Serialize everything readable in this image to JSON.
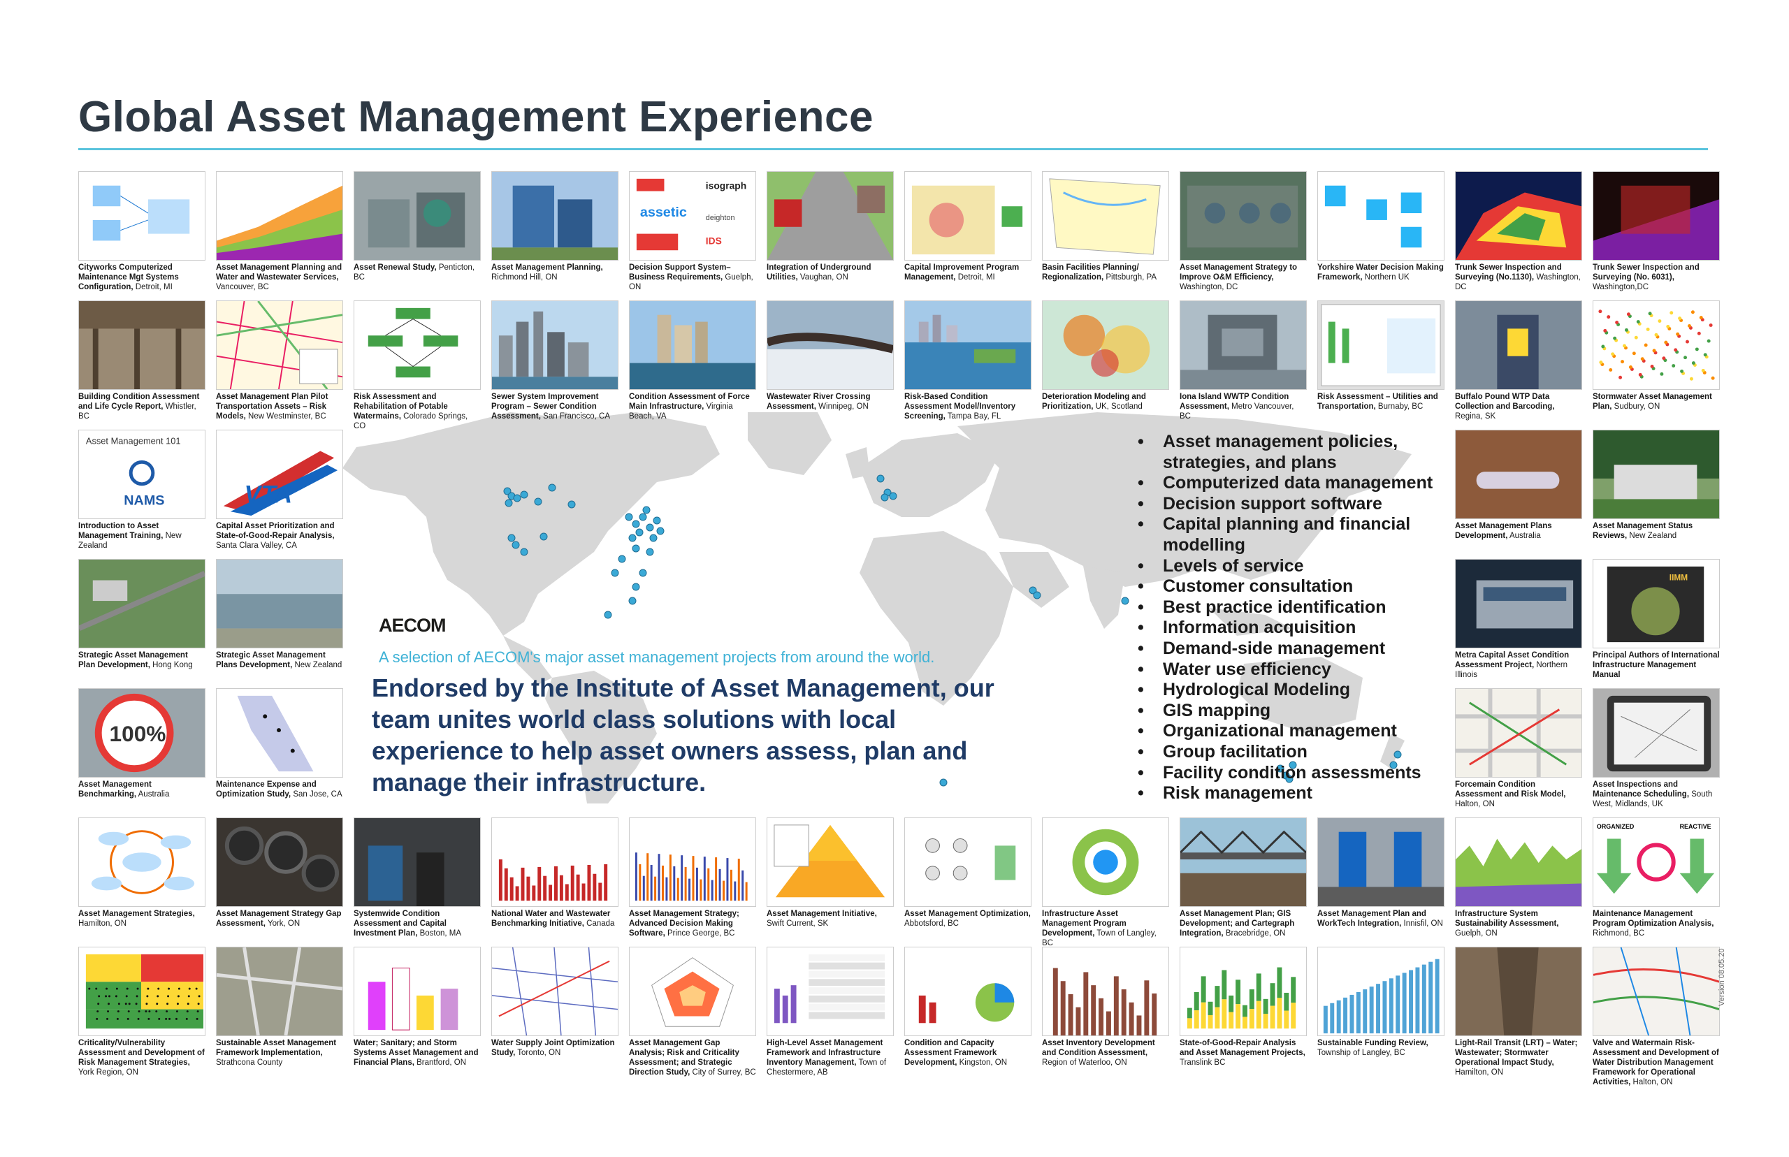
{
  "title": "Global Asset Management Experience",
  "brand": "AECOM",
  "tagline": "A selection of AECOM's major asset management projects from around the world.",
  "endorsement": "Endorsed by the Institute of Asset Management, our team unites world class solutions with local experience to help asset owners assess, plan and manage their infrastructure.",
  "version": "Version 08.05.20",
  "colors": {
    "accent": "#5bc4dd",
    "navy": "#1f3b66",
    "heading": "#2e3944",
    "dot": "#3aa9d6",
    "map": "#d7d7d7"
  },
  "services": [
    "Asset management policies, strategies, and plans",
    "Computerized data management",
    "Decision support software",
    "Capital planning and financial modelling",
    "Levels of service",
    "Customer consultation",
    "Best practice identification",
    "Information acquisition",
    "Demand-side management",
    "Water use efficiency",
    "Hydrological Modeling",
    "GIS mapping",
    "Organizational management",
    "Group facilitation",
    "Facility condition assessments",
    "Risk management"
  ],
  "projects": [
    {
      "title": "Cityworks Computerized Maintenance Mgt Systems Configuration,",
      "loc": "Detroit, MI",
      "thumb": "diagram"
    },
    {
      "title": "Asset Management Planning and Water and Wastewater Services,",
      "loc": "Vancouver, BC",
      "thumb": "areachart"
    },
    {
      "title": "Asset Renewal Study,",
      "loc": "Penticton, BC",
      "thumb": "plant"
    },
    {
      "title": "Asset Management Planning,",
      "loc": "Richmond Hill, ON",
      "thumb": "building"
    },
    {
      "title": "Decision Support System– Business Requirements,",
      "loc": "Guelph, ON",
      "thumb": "logos"
    },
    {
      "title": "Integration of Underground Utilities,",
      "loc": "Vaughan, ON",
      "thumb": "street"
    },
    {
      "title": "Capital Improvement Program Management,",
      "loc": "Detroit, MI",
      "thumb": "map-red"
    },
    {
      "title": "Basin Facilities Planning/ Regionalization,",
      "loc": "Pittsburgh, PA",
      "thumb": "map-yellow"
    },
    {
      "title": "Asset Management Strategy to Improve O&M Efficiency,",
      "loc": "Washington, DC",
      "thumb": "aerial"
    },
    {
      "title": "Yorkshire Water Decision Making Framework,",
      "loc": "Northern UK",
      "thumb": "flow"
    },
    {
      "title": "Trunk Sewer Inspection and Surveying (No.1130),",
      "loc": "Washington, DC",
      "thumb": "scan"
    },
    {
      "title": "Trunk Sewer Inspection and Surveying (No. 6031),",
      "loc": "Washington,DC",
      "thumb": "scan-dark"
    },
    {
      "title": "Building Condition Assessment and Life Cycle Report,",
      "loc": "Whistler, BC",
      "thumb": "structure"
    },
    {
      "title": "Asset Management Plan Pilot Transportation Assets – Risk Models,",
      "loc": "New Westminster, BC",
      "thumb": "map-grid"
    },
    {
      "title": "Risk Assessment and Rehabilitation of Potable Watermains,",
      "loc": "Colorado Springs, CO",
      "thumb": "flow-green"
    },
    {
      "title": "Sewer System Improvement Program – Sewer Condition Assessment,",
      "loc": "San Francisco, CA",
      "thumb": "city"
    },
    {
      "title": "Condition Assessment of Force Main Infrastructure,",
      "loc": "Virginia Beach, VA",
      "thumb": "city-coast"
    },
    {
      "title": "Wastewater River Crossing Assessment,",
      "loc": "Winnipeg, ON",
      "thumb": "snow"
    },
    {
      "title": "Risk-Based Condition Assessment Model/Inventory Screening,",
      "loc": "Tampa Bay, FL",
      "thumb": "bay"
    },
    {
      "title": "Deterioration Modeling and Prioritization,",
      "loc": "UK, Scotland",
      "thumb": "map-heat"
    },
    {
      "title": "Iona Island WWTP Condition Assessment,",
      "loc": "Metro Vancouver, BC",
      "thumb": "facility"
    },
    {
      "title": "Risk Assessment – Utilities and Transportation,",
      "loc": "Burnaby, BC",
      "thumb": "software"
    },
    {
      "title": "Buffalo Pound WTP Data Collection and Barcoding,",
      "loc": "Regina, SK",
      "thumb": "worker"
    },
    {
      "title": "Stormwater Asset Management Plan,",
      "loc": "Sudbury, ON",
      "thumb": "scatter"
    },
    {
      "title": "Introduction to Asset Management Training,",
      "loc": "New Zealand",
      "thumb": "nams"
    },
    {
      "title": "Capital Asset Prioritization and State-of-Good-Repair Analysis,",
      "loc": "Santa Clara Valley, CA",
      "thumb": "vta"
    },
    {
      "title": "Asset Management Plans Development,",
      "loc": "Australia",
      "thumb": "trench"
    },
    {
      "title": "Asset Management Status Reviews,",
      "loc": "New Zealand",
      "thumb": "house"
    },
    {
      "title": "Strategic Asset Management Plan Development,",
      "loc": "Hong Kong",
      "thumb": "aerial-green"
    },
    {
      "title": "Strategic Asset Management Plans Development,",
      "loc": "New Zealand",
      "thumb": "lake"
    },
    {
      "title": "Metra Capital Asset Condition Assessment Project,",
      "loc": "Northern Illinois",
      "thumb": "train"
    },
    {
      "title": "Principal Authors of International Infrastructure Management Manual",
      "loc": "",
      "thumb": "book"
    },
    {
      "title": "Asset Management Benchmarking,",
      "loc": "Australia",
      "thumb": "hundred"
    },
    {
      "title": "Maintenance Expense and Optimization Study,",
      "loc": "San Jose, CA",
      "thumb": "map-ca"
    },
    {
      "title": "Forcemain Condition Assessment and Risk Model,",
      "loc": "Halton, ON",
      "thumb": "map-streets"
    },
    {
      "title": "Asset Inspections and Maintenance Scheduling,",
      "loc": "South West, Midlands, UK",
      "thumb": "tablet"
    },
    {
      "title": "Asset Management Strategies,",
      "loc": "Hamilton, ON",
      "thumb": "cycle"
    },
    {
      "title": "Asset Management Strategy Gap Assessment,",
      "loc": "York, ON",
      "thumb": "pipes"
    },
    {
      "title": "Systemwide Condition Assessment and Capital Investment Plan,",
      "loc": "Boston, MA",
      "thumb": "subway"
    },
    {
      "title": "National Water and Wastewater Benchmarking Initiative,",
      "loc": "Canada",
      "thumb": "barchart-red"
    },
    {
      "title": "Asset Management Strategy; Advanced Decision Making Software,",
      "loc": "Prince George, BC",
      "thumb": "barchart-multi"
    },
    {
      "title": "Asset Management Initiative,",
      "loc": "Swift Current, SK",
      "thumb": "pyramid"
    },
    {
      "title": "Asset Management Optimization,",
      "loc": "Abbotsford, BC",
      "thumb": "flow-small"
    },
    {
      "title": "Infrastructure Asset Management Program Development,",
      "loc": "Town of Langley, BC",
      "thumb": "wheel"
    },
    {
      "title": "Asset Management Plan; GIS Development; and Cartegraph Integration,",
      "loc": "Bracebridge, ON",
      "thumb": "bridge"
    },
    {
      "title": "Asset Management Plan and WorkTech Integration,",
      "loc": "Innisfil, ON",
      "thumb": "pumps"
    },
    {
      "title": "Infrastructure System Sustainability Assessment,",
      "loc": "Guelph, ON",
      "thumb": "area-green"
    },
    {
      "title": "Maintenance Management Program Optimization Analysis,",
      "loc": "Richmond, BC",
      "thumb": "reactive"
    },
    {
      "title": "Criticality/Vulnerability Assessment and Development of Risk Management Strategies,",
      "loc": "York Region, ON",
      "thumb": "riskmatrix"
    },
    {
      "title": "Sustainable Asset Management Framework Implementation,",
      "loc": "Strathcona County",
      "thumb": "aerial-map"
    },
    {
      "title": "Water; Sanitary; and Storm Systems Asset Management and Financial Plans,",
      "loc": "Brantford, ON",
      "thumb": "barchart-pink"
    },
    {
      "title": "Water Supply Joint Optimization Study,",
      "loc": "Toronto, ON",
      "thumb": "network"
    },
    {
      "title": "Asset Management Gap Analysis; Risk and Criticality Assessment; and Strategic Direction Study,",
      "loc": "City of Surrey, BC",
      "thumb": "radar"
    },
    {
      "title": "High-Level Asset Management Framework and Infrastructure Inventory Management,",
      "loc": "Town of Chestermere, AB",
      "thumb": "table"
    },
    {
      "title": "Condition and Capacity Assessment Framework Development,",
      "loc": "Kingston, ON",
      "thumb": "pie"
    },
    {
      "title": "Asset Inventory Development and Condition Assessment,",
      "loc": "Region of Waterloo, ON",
      "thumb": "barchart-brown"
    },
    {
      "title": "State-of-Good-Repair Analysis and Asset Management Projects,",
      "loc": "Translink BC",
      "thumb": "stacked"
    },
    {
      "title": "Sustainable Funding Review,",
      "loc": "Township of Langley, BC",
      "thumb": "bars-blue"
    },
    {
      "title": "Light-Rail Transit (LRT) – Water; Wastewater; Stormwater Operational Impact Study,",
      "loc": "Hamilton, ON",
      "thumb": "excavation"
    },
    {
      "title": "Valve and Watermain Risk-Assessment and Development of Water Distribution Management Framework for Operational Activities,",
      "loc": "Halton, ON",
      "thumb": "map-lines"
    }
  ]
}
